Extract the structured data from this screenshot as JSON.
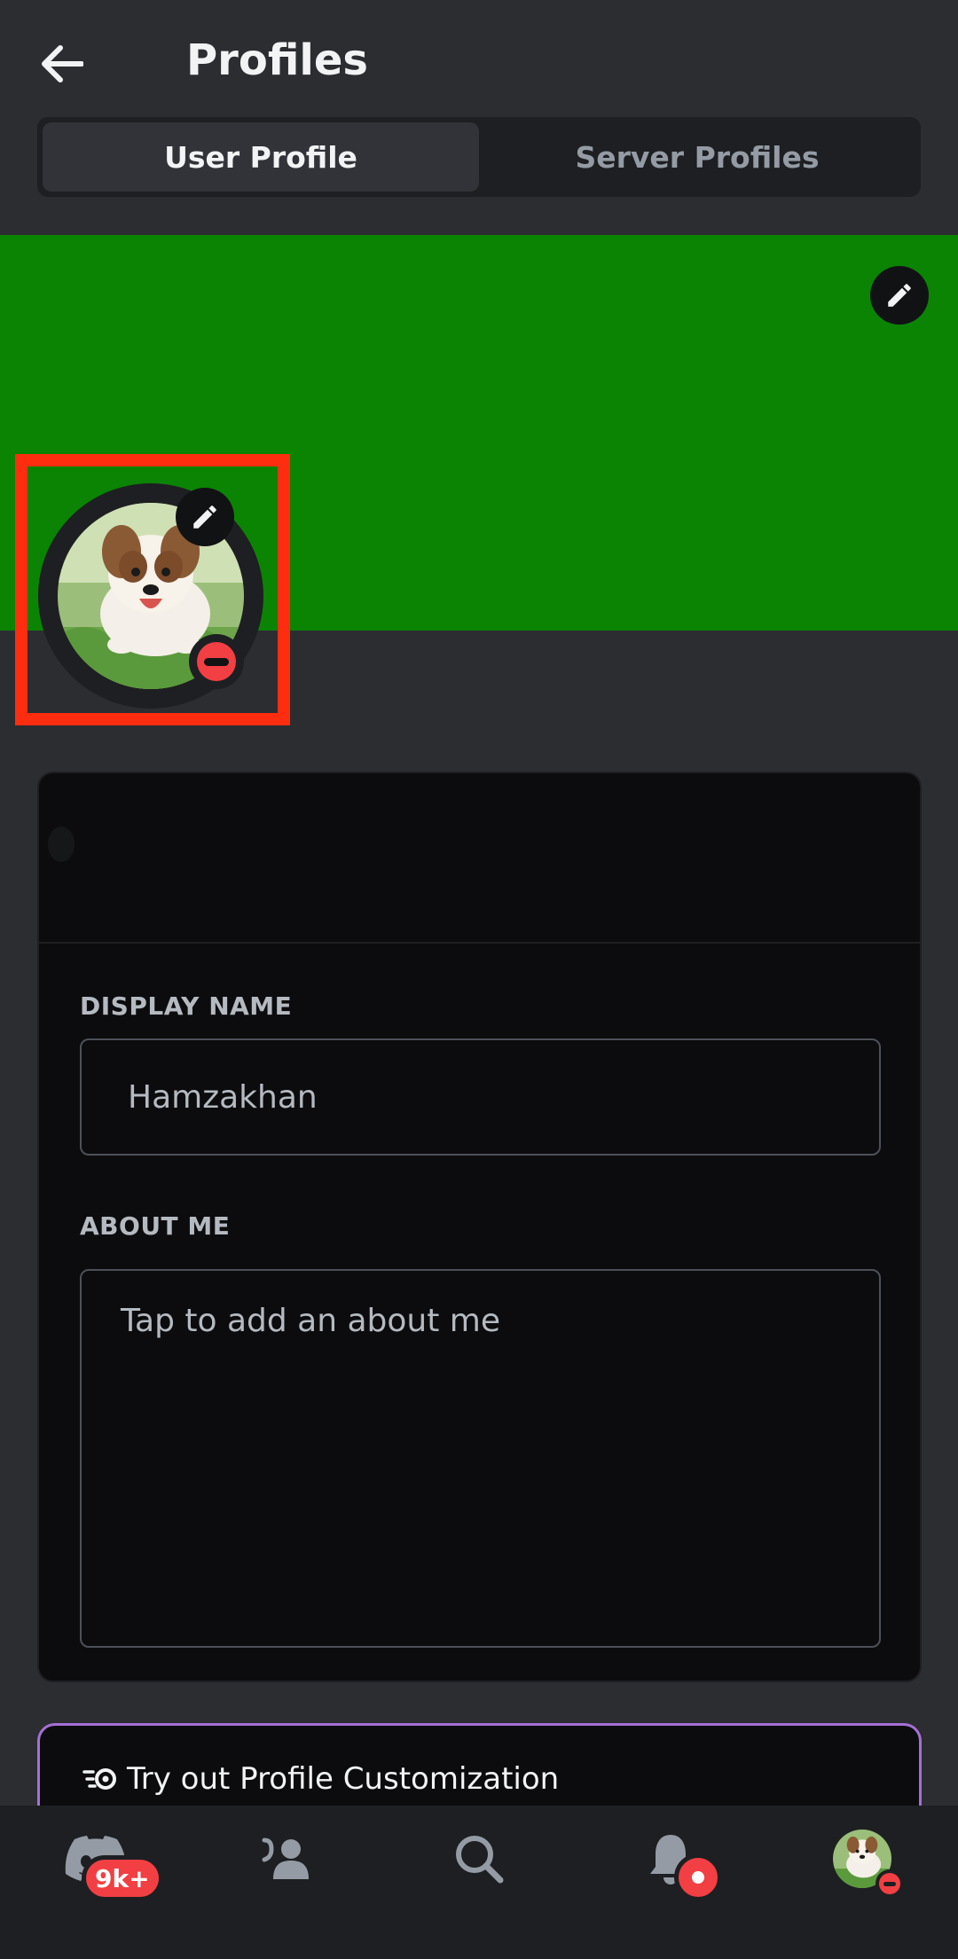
{
  "header": {
    "title": "Profiles",
    "back_icon": "arrow-left-icon"
  },
  "tabs": [
    {
      "label": "User Profile",
      "active": true
    },
    {
      "label": "Server Profiles",
      "active": false
    }
  ],
  "banner": {
    "color": "#0b8404",
    "edit_icon": "pencil-icon"
  },
  "avatar": {
    "image": "puppy-photo",
    "edit_icon": "pencil-icon",
    "status": "do-not-disturb"
  },
  "form": {
    "display_name_label": "DISPLAY NAME",
    "display_name_value": "Hamzakhan",
    "about_me_label": "ABOUT ME",
    "about_me_placeholder": "Tap to add an about me"
  },
  "promo": {
    "text": "Try out Profile Customization",
    "icon": "nitro-icon",
    "border_color": "#a66fd6"
  },
  "bottom_nav": {
    "items": [
      {
        "name": "home",
        "icon": "discord-logo-icon",
        "badge": "9k+"
      },
      {
        "name": "friends",
        "icon": "friends-icon"
      },
      {
        "name": "search",
        "icon": "search-icon"
      },
      {
        "name": "notifications",
        "icon": "bell-icon",
        "badge": "dot"
      },
      {
        "name": "profile",
        "icon": "avatar-icon",
        "status": "do-not-disturb"
      }
    ]
  },
  "colors": {
    "background": "#2b2d31",
    "accent_red": "#f23f43",
    "highlight": "#ff2d10"
  }
}
